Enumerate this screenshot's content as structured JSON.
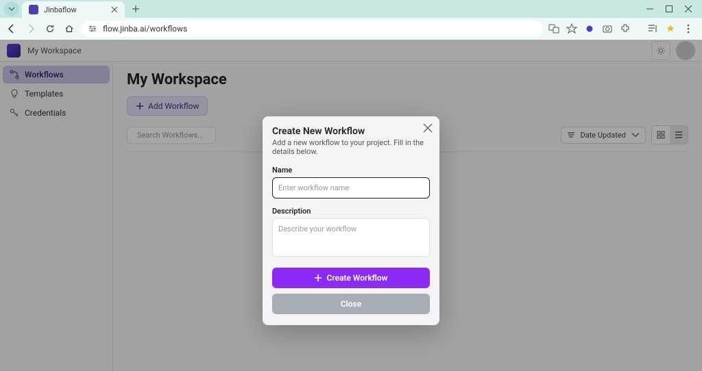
{
  "browser": {
    "tab_title": "Jinbaflow",
    "url": "flow.jinba.ai/workflows"
  },
  "header": {
    "breadcrumb": "My Workspace"
  },
  "sidebar": {
    "items": [
      {
        "label": "Workflows",
        "icon": "flow-icon",
        "active": true
      },
      {
        "label": "Templates",
        "icon": "bulb-icon",
        "active": false
      },
      {
        "label": "Credentials",
        "icon": "key-icon",
        "active": false
      }
    ]
  },
  "main": {
    "title": "My Workspace",
    "add_button": "Add Workflow",
    "search_placeholder": "Search Workflows...",
    "sort_label": "Date Updated"
  },
  "modal": {
    "title": "Create New Workflow",
    "subtitle": "Add a new workflow to your project. Fill in the details below.",
    "name_label": "Name",
    "name_placeholder": "Enter workflow name",
    "name_value": "",
    "desc_label": "Description",
    "desc_placeholder": "Describe your workflow",
    "desc_value": "",
    "create_label": "Create Workflow",
    "close_label": "Close"
  },
  "colors": {
    "accent": "#8a2cf5",
    "sidebar_active": "#c9c5ea"
  }
}
